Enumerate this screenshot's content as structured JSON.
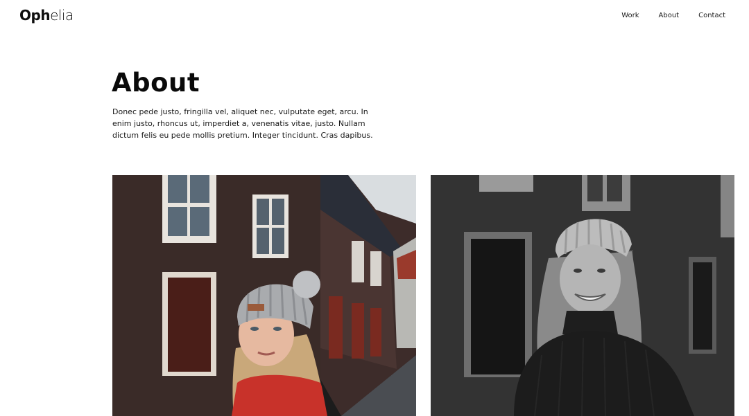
{
  "brand": {
    "prefix": "Oph",
    "suffix": "elia"
  },
  "nav": {
    "items": [
      "Work",
      "About",
      "Contact"
    ]
  },
  "page": {
    "title": "About",
    "intro": "Donec pede justo, fringilla vel, aliquet nec, vulputate eget, arcu. In enim justo, rhoncus ut, imperdiet a, venenatis vitae, justo. Nullam dictum felis eu pede mollis pretium. Integer tincidunt. Cras dapibus."
  },
  "photos": [
    {
      "kind": "color",
      "accent": "#c8322a"
    },
    {
      "kind": "grayscale",
      "accent": "#8a8a8a"
    }
  ]
}
